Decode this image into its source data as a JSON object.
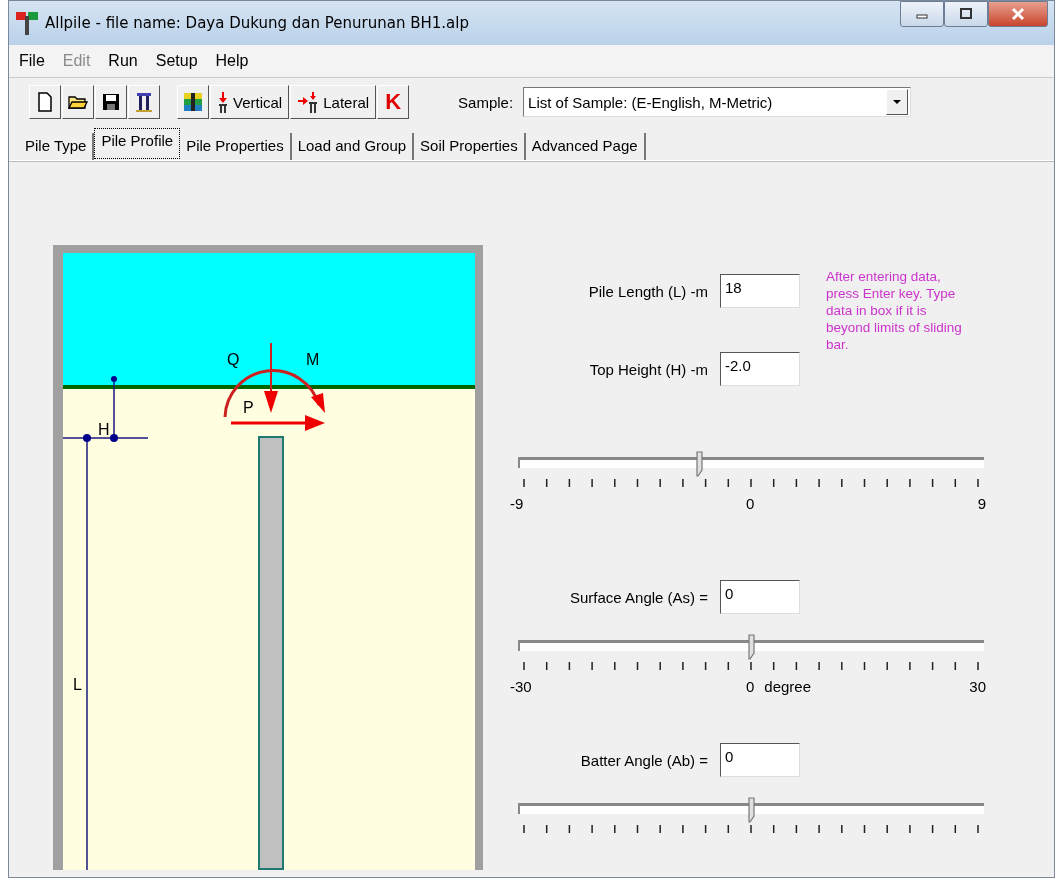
{
  "window": {
    "title": "Allpile - file name: Daya Dukung dan Penurunan BH1.alp"
  },
  "menu": [
    {
      "label": "File",
      "disabled": false
    },
    {
      "label": "Edit",
      "disabled": true
    },
    {
      "label": "Run",
      "disabled": false
    },
    {
      "label": "Setup",
      "disabled": false
    },
    {
      "label": "Help",
      "disabled": false
    }
  ],
  "toolbar": {
    "text_buttons": [
      {
        "kind": "vertical",
        "label": "Vertical"
      },
      {
        "kind": "lateral",
        "label": "Lateral"
      },
      {
        "kind": "letter",
        "label": "K"
      }
    ]
  },
  "sample": {
    "label": "Sample:",
    "value": "List of Sample:  (E-English, M-Metric)"
  },
  "tabs": [
    {
      "label": "Pile Type",
      "selected": false
    },
    {
      "label": "Pile Profile",
      "selected": true
    },
    {
      "label": "Pile Properties",
      "selected": false
    },
    {
      "label": "Load and Group",
      "selected": false
    },
    {
      "label": "Soil Properties",
      "selected": false
    },
    {
      "label": "Advanced Page",
      "selected": false
    }
  ],
  "diagram": {
    "load_label": "Q",
    "moment_label": "M",
    "lateral_label": "P",
    "height_label": "H",
    "length_label": "L"
  },
  "sections": [
    {
      "inputs": [
        {
          "label": "Pile Length (L) -m",
          "value": "18"
        },
        {
          "label": "Top Height (H) -m",
          "value": "-2.0"
        }
      ],
      "hint": "After entering data, press Enter key. Type data in box if it is beyond limits of sliding bar.",
      "slider": {
        "level": 0.389,
        "min_label": "-9",
        "mid_label": "0",
        "max_label": "9"
      }
    },
    {
      "inputs": [
        {
          "label": "Surface Angle (As) =",
          "value": "0"
        }
      ],
      "slider": {
        "level": 0.5,
        "min_label": "-30",
        "mid_label": "0",
        "unit": "degree",
        "max_label": "30"
      }
    },
    {
      "inputs": [
        {
          "label": "Batter Angle (Ab) =",
          "value": "0"
        }
      ],
      "slider": {
        "level": 0.5
      }
    }
  ]
}
